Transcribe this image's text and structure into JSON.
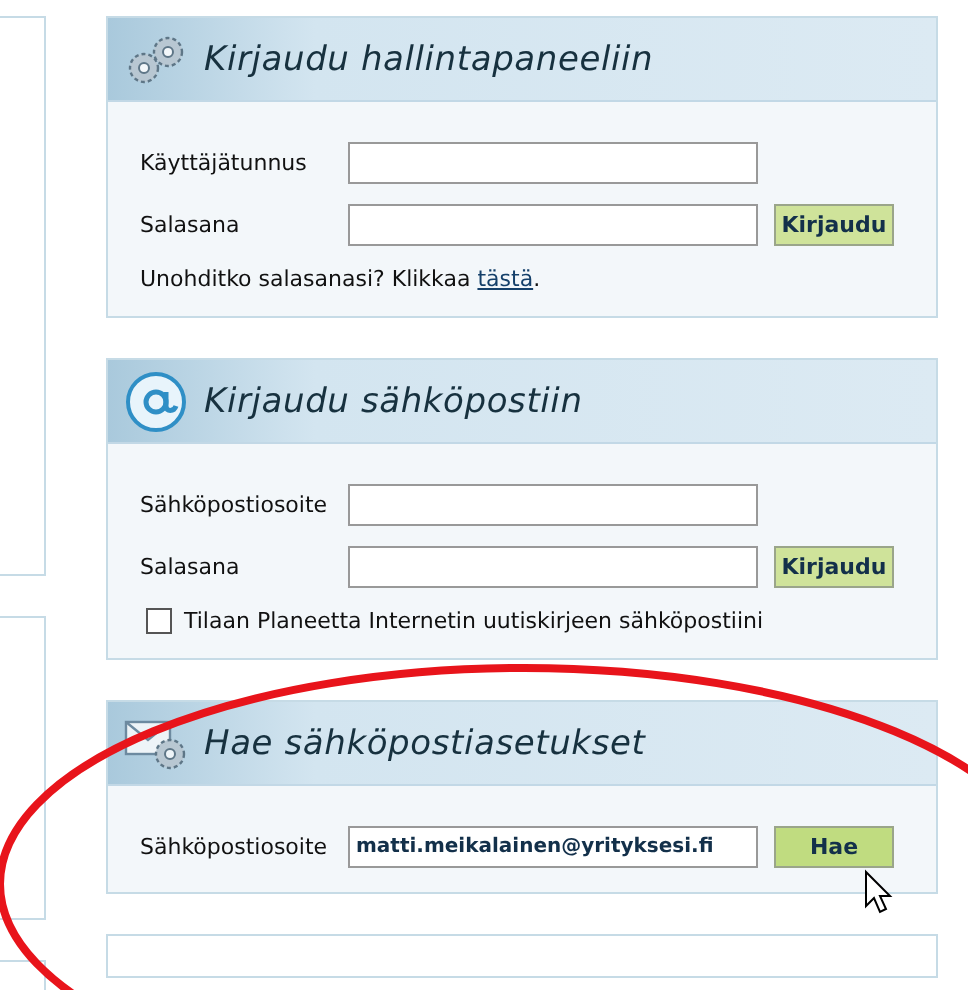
{
  "panels": [
    {
      "kind": "gears",
      "title": "Kirjaudu hallintapaneeliin",
      "fields": [
        {
          "label": "Käyttäjätunnus"
        },
        {
          "label": "Salasana",
          "button": "Kirjaudu"
        }
      ],
      "footer": {
        "text": "Unohditko salasanasi? Klikkaa ",
        "link": "tästä",
        "end": "."
      }
    },
    {
      "kind": "at",
      "title": "Kirjaudu sähköpostiin",
      "fields": [
        {
          "label": "Sähköpostiosoite"
        },
        {
          "label": "Salasana",
          "button": "Kirjaudu"
        }
      ],
      "checkbox": {
        "label": "Tilaan Planeetta Internetin uutiskirjeen sähköpostiini",
        "checked": false
      }
    },
    {
      "kind": "mail",
      "title": "Hae sähköpostiasetukset",
      "fields": [
        {
          "label": "Sähköpostiosoite",
          "value": "matti.meikalainen@yrityksesi.fi",
          "button": "Hae",
          "hovered": true
        }
      ]
    }
  ]
}
